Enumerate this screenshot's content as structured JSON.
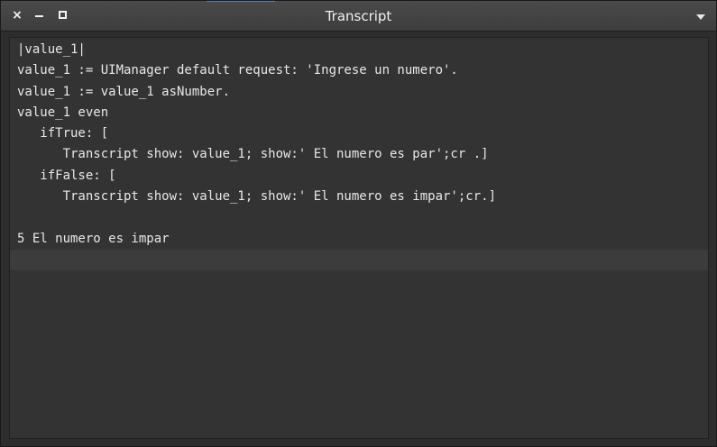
{
  "window": {
    "title": "Transcript"
  },
  "titlebar_buttons": {
    "close_label": "×"
  },
  "transcript": {
    "lines": [
      "|value_1|",
      "value_1 := UIManager default request: 'Ingrese un numero'.",
      "value_1 := value_1 asNumber.",
      "value_1 even",
      "   ifTrue: [",
      "      Transcript show: value_1; show:' El numero es par';cr .]",
      "   ifFalse: [",
      "      Transcript show: value_1; show:' El numero es impar';cr.]",
      "",
      "5 El numero es impar",
      ""
    ]
  },
  "colors": {
    "background": "#2d2d2d",
    "text": "#e8e8e8",
    "current_line": "#3c3c3c"
  },
  "icons": [
    "close-icon",
    "minimize-icon",
    "maximize-icon",
    "menu-arrow-icon"
  ]
}
